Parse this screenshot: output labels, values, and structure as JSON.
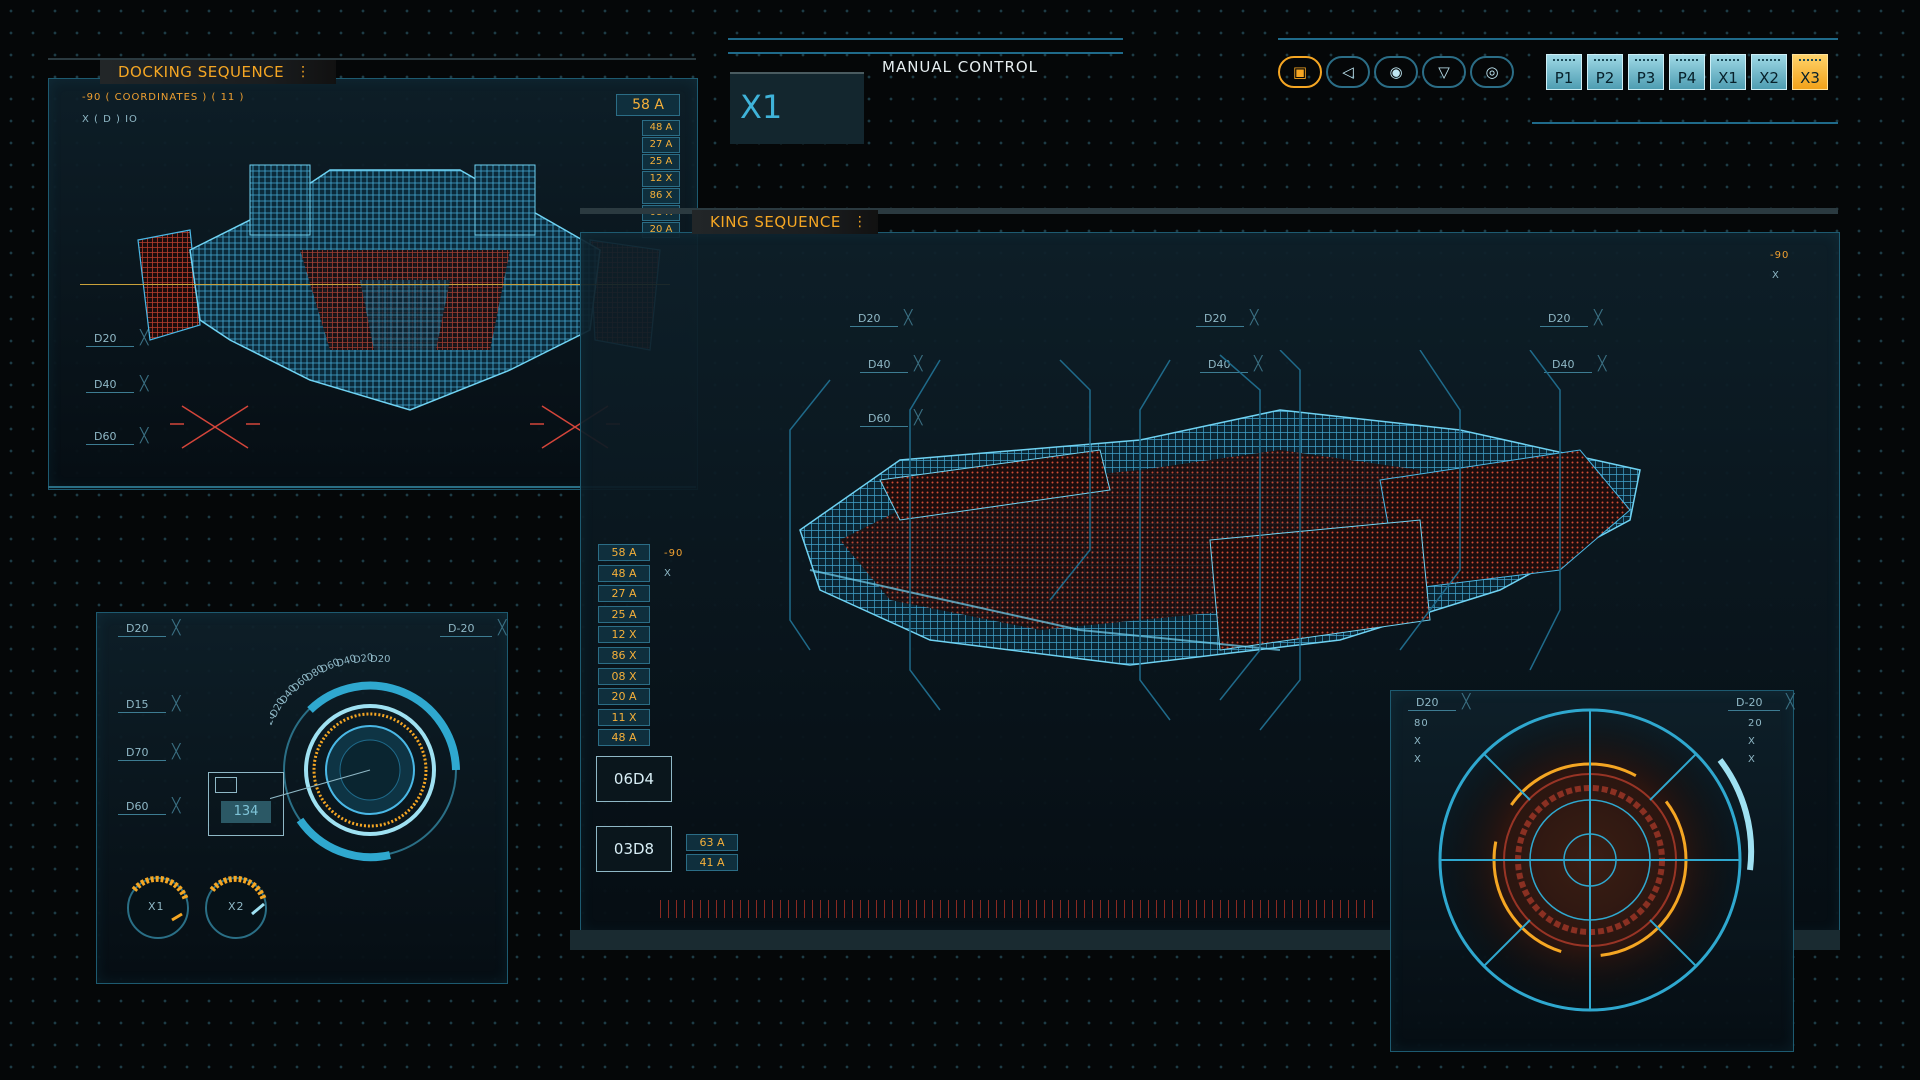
{
  "top_left_panel": {
    "title": "DOCKING SEQUENCE",
    "coord_line_1": "-90  ( COORDINATES ) ( 11 )",
    "coord_line_2": "X      ( D ) IO",
    "main_chip": "58 A",
    "chips": [
      "48 A",
      "27 A",
      "25 A",
      "12 X",
      "86 X",
      "08 X",
      "20 A"
    ],
    "tags": [
      "D20",
      "D40",
      "D60"
    ]
  },
  "manual_control": {
    "label": "MANUAL CONTROL",
    "display": "X1"
  },
  "toolbar": {
    "icon_buttons": [
      {
        "icon": "target-square-icon",
        "glyph": "▣",
        "active": true
      },
      {
        "icon": "arrow-left-icon",
        "glyph": "◁",
        "active": false
      },
      {
        "icon": "crosshair-icon",
        "glyph": "◉",
        "active": false
      },
      {
        "icon": "arrow-down-icon",
        "glyph": "▽",
        "active": false
      },
      {
        "icon": "ring-icon",
        "glyph": "◎",
        "active": false
      }
    ],
    "preset_buttons": [
      "P1",
      "P2",
      "P3",
      "P4",
      "X1",
      "X2",
      "X3"
    ],
    "active_preset": "X3"
  },
  "main_panel": {
    "title": "KING SEQUENCE",
    "corner_value": "-90",
    "corner_marker": "X",
    "tags": [
      "D20",
      "D40",
      "D60",
      "D20",
      "D40",
      "D20",
      "D40"
    ],
    "side_value": "-90",
    "side_marker": "X",
    "chips": [
      "58 A",
      "48 A",
      "27 A",
      "25 A",
      "12 X",
      "86 X",
      "08 X",
      "20 A",
      "11 X",
      "48 A"
    ],
    "box_1": "06D4",
    "box_2": "03D8",
    "box_2_chips": [
      "63 A",
      "41 A"
    ]
  },
  "gauge_panel": {
    "tags": [
      "D20",
      "D15",
      "D70",
      "D60"
    ],
    "tag_right": "D-20",
    "arc_labels": [
      "D20",
      "D20",
      "D40",
      "D60",
      "D80",
      "D60",
      "D40",
      "D20",
      "D20"
    ],
    "readout": "134",
    "dial_1": "X1",
    "dial_2": "X2"
  },
  "radar_panel": {
    "tag_left": "D20",
    "tag_right": "D-20",
    "left_values": [
      "80",
      "X",
      "X"
    ],
    "right_values": [
      "20",
      "X",
      "X"
    ]
  },
  "colors": {
    "accent": "#f5a623",
    "cyan": "#2fa8cf",
    "red_wire": "#c8412f",
    "blue_wire": "#4ab8e6"
  }
}
